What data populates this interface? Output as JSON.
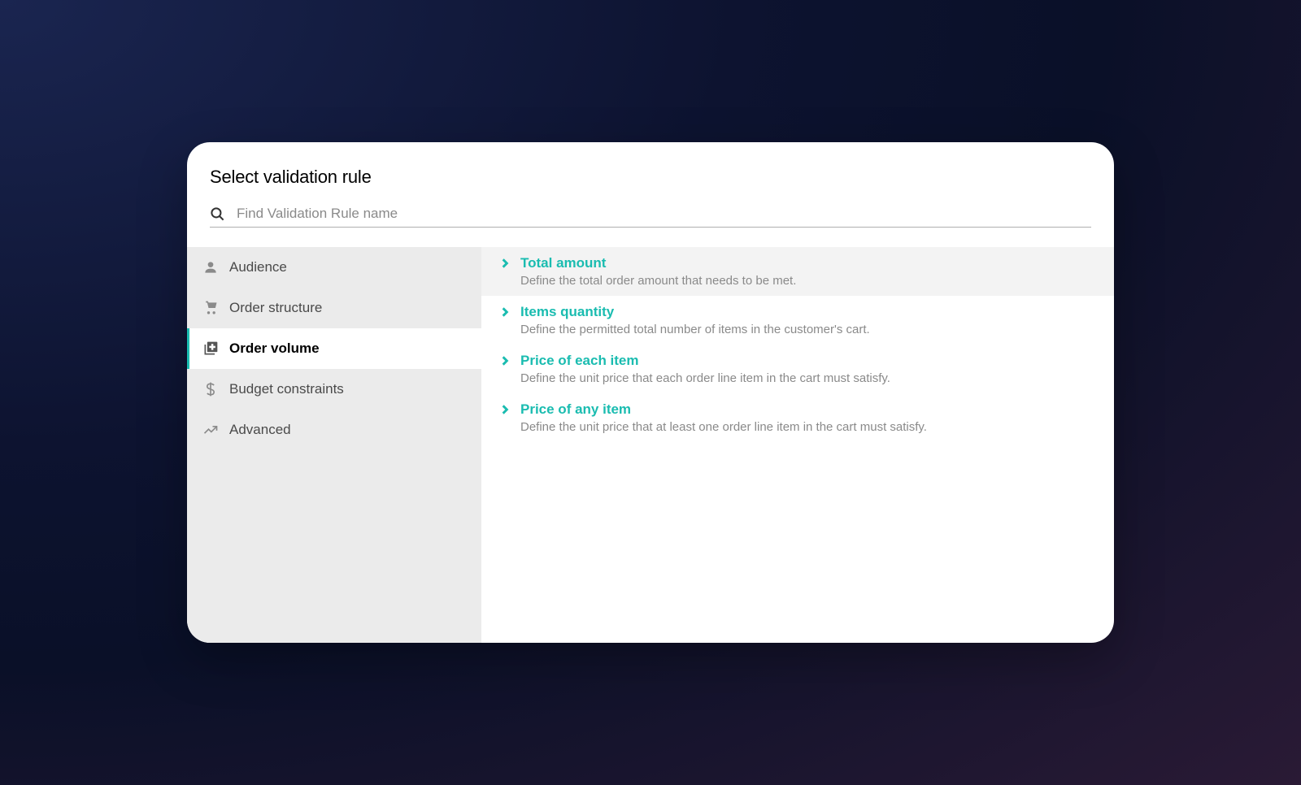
{
  "header": {
    "title": "Select validation rule"
  },
  "search": {
    "placeholder": "Find Validation Rule name"
  },
  "sidebar": {
    "items": [
      {
        "label": "Audience",
        "icon": "person",
        "active": false
      },
      {
        "label": "Order structure",
        "icon": "cart",
        "active": false
      },
      {
        "label": "Order volume",
        "icon": "add-box",
        "active": true
      },
      {
        "label": "Budget constraints",
        "icon": "dollar",
        "active": false
      },
      {
        "label": "Advanced",
        "icon": "trend",
        "active": false
      }
    ]
  },
  "rules": [
    {
      "title": "Total amount",
      "description": "Define the total order amount that needs to be met.",
      "highlighted": true
    },
    {
      "title": "Items quantity",
      "description": "Define the permitted total number of items in the customer's cart.",
      "highlighted": false
    },
    {
      "title": "Price of each item",
      "description": "Define the unit price that each order line item in the cart must satisfy.",
      "highlighted": false
    },
    {
      "title": "Price of any item",
      "description": "Define the unit price that at least one order line item in the cart must satisfy.",
      "highlighted": false
    }
  ]
}
